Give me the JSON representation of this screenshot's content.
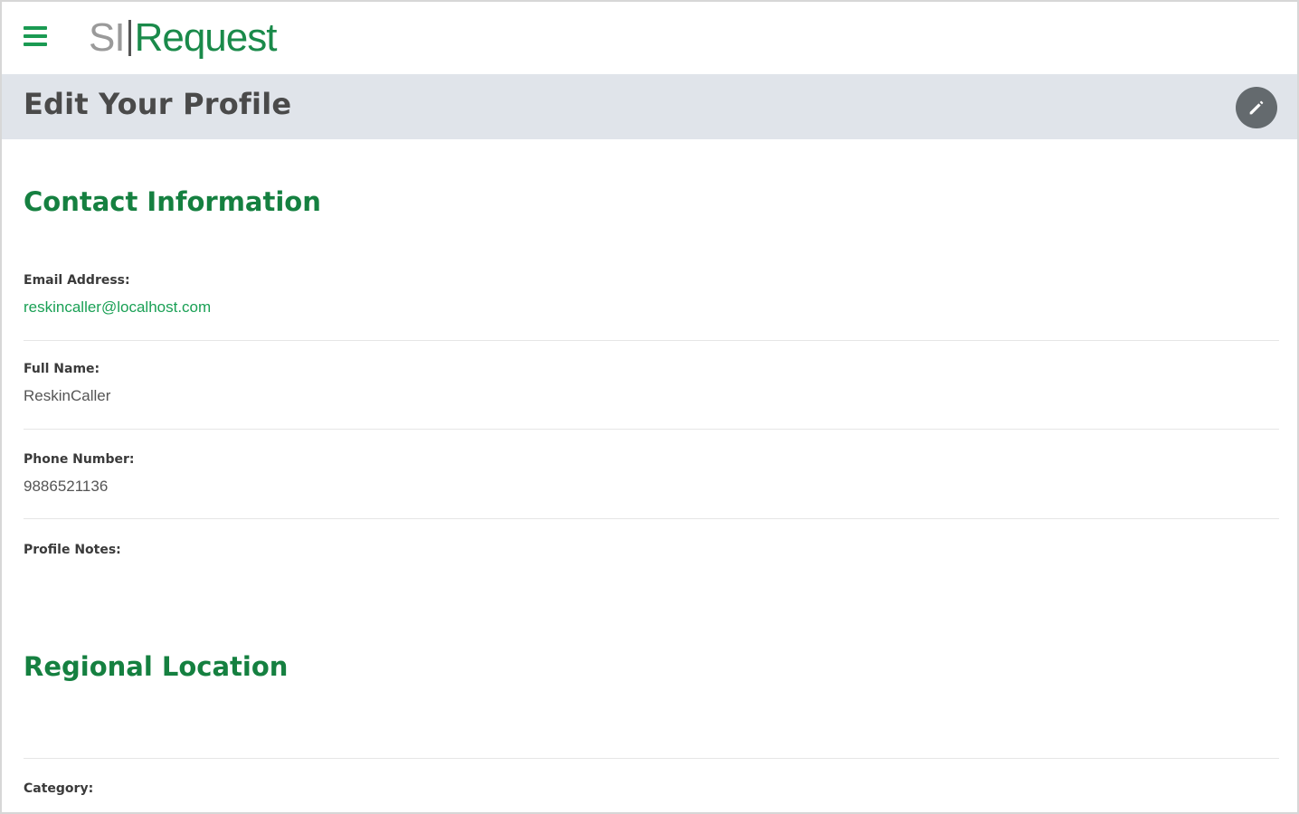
{
  "app": {
    "logo_prefix": "SI",
    "logo_suffix": "Request"
  },
  "header": {
    "title": "Edit Your Profile"
  },
  "sections": {
    "contact": {
      "title": "Contact Information",
      "email_label": "Email Address:",
      "email_value": "reskincaller@localhost.com",
      "name_label": "Full Name:",
      "name_value": "ReskinCaller",
      "phone_label": "Phone Number:",
      "phone_value": "9886521136",
      "notes_label": "Profile Notes:",
      "notes_value": ""
    },
    "regional": {
      "title": "Regional Location",
      "category_label": "Category:"
    }
  },
  "colors": {
    "brand_green": "#1a8a4a",
    "header_band": "#e0e4ea",
    "edit_button": "#646a6e"
  },
  "icons": {
    "menu": "hamburger-menu-icon",
    "edit": "pencil-icon"
  }
}
